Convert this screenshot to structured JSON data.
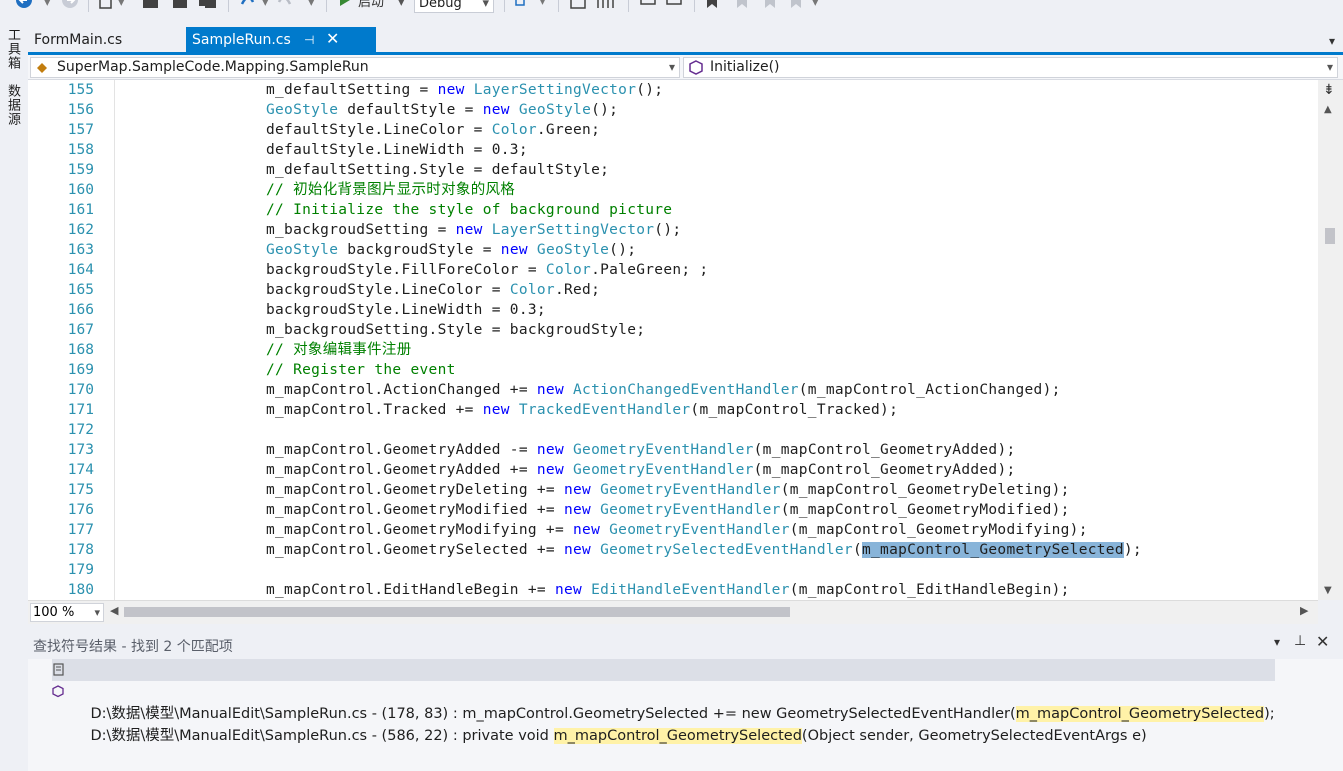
{
  "toolbar": {
    "start_label": "启动",
    "config_value": "Debug"
  },
  "left_strip": {
    "items": [
      {
        "label": "工具箱"
      },
      {
        "label": "数据源"
      }
    ]
  },
  "tabs": [
    {
      "label": "FormMain.cs",
      "active": false
    },
    {
      "label": "SampleRun.cs",
      "active": true
    }
  ],
  "navbar": {
    "class_value": "SuperMap.SampleCode.Mapping.SampleRun",
    "member_value": "Initialize()"
  },
  "editor": {
    "lines": [
      {
        "n": "155",
        "parts": [
          [
            "",
            "m_defaultSetting = "
          ],
          [
            "kw",
            "new"
          ],
          [
            "",
            " "
          ],
          [
            "ty",
            "LayerSettingVector"
          ],
          [
            "",
            "();"
          ]
        ]
      },
      {
        "n": "156",
        "parts": [
          [
            "ty",
            "GeoStyle"
          ],
          [
            "",
            " defaultStyle = "
          ],
          [
            "kw",
            "new"
          ],
          [
            "",
            " "
          ],
          [
            "ty",
            "GeoStyle"
          ],
          [
            "",
            "();"
          ]
        ]
      },
      {
        "n": "157",
        "parts": [
          [
            "",
            "defaultStyle.LineColor = "
          ],
          [
            "ty",
            "Color"
          ],
          [
            "",
            ".Green;"
          ]
        ]
      },
      {
        "n": "158",
        "parts": [
          [
            "",
            "defaultStyle.LineWidth = 0.3;"
          ]
        ]
      },
      {
        "n": "159",
        "parts": [
          [
            "",
            "m_defaultSetting.Style = defaultStyle;"
          ]
        ]
      },
      {
        "n": "160",
        "parts": [
          [
            "cm",
            "// 初始化背景图片显示时对象的风格"
          ]
        ]
      },
      {
        "n": "161",
        "parts": [
          [
            "cm",
            "// Initialize the style of background picture"
          ]
        ]
      },
      {
        "n": "162",
        "parts": [
          [
            "",
            "m_backgroudSetting = "
          ],
          [
            "kw",
            "new"
          ],
          [
            "",
            " "
          ],
          [
            "ty",
            "LayerSettingVector"
          ],
          [
            "",
            "();"
          ]
        ]
      },
      {
        "n": "163",
        "parts": [
          [
            "ty",
            "GeoStyle"
          ],
          [
            "",
            " backgroudStyle = "
          ],
          [
            "kw",
            "new"
          ],
          [
            "",
            " "
          ],
          [
            "ty",
            "GeoStyle"
          ],
          [
            "",
            "();"
          ]
        ]
      },
      {
        "n": "164",
        "parts": [
          [
            "",
            "backgroudStyle.FillForeColor = "
          ],
          [
            "ty",
            "Color"
          ],
          [
            "",
            ".PaleGreen; ;"
          ]
        ]
      },
      {
        "n": "165",
        "parts": [
          [
            "",
            "backgroudStyle.LineColor = "
          ],
          [
            "ty",
            "Color"
          ],
          [
            "",
            ".Red;"
          ]
        ]
      },
      {
        "n": "166",
        "parts": [
          [
            "",
            "backgroudStyle.LineWidth = 0.3;"
          ]
        ]
      },
      {
        "n": "167",
        "parts": [
          [
            "",
            "m_backgroudSetting.Style = backgroudStyle;"
          ]
        ]
      },
      {
        "n": "168",
        "parts": [
          [
            "cm",
            "// 对象编辑事件注册"
          ]
        ]
      },
      {
        "n": "169",
        "parts": [
          [
            "cm",
            "// Register the event"
          ]
        ]
      },
      {
        "n": "170",
        "parts": [
          [
            "",
            "m_mapControl.ActionChanged += "
          ],
          [
            "kw",
            "new"
          ],
          [
            "",
            " "
          ],
          [
            "ty",
            "ActionChangedEventHandler"
          ],
          [
            "",
            "(m_mapControl_ActionChanged);"
          ]
        ]
      },
      {
        "n": "171",
        "parts": [
          [
            "",
            "m_mapControl.Tracked += "
          ],
          [
            "kw",
            "new"
          ],
          [
            "",
            " "
          ],
          [
            "ty",
            "TrackedEventHandler"
          ],
          [
            "",
            "(m_mapControl_Tracked);"
          ]
        ]
      },
      {
        "n": "172",
        "parts": []
      },
      {
        "n": "173",
        "parts": [
          [
            "",
            "m_mapControl.GeometryAdded -= "
          ],
          [
            "kw",
            "new"
          ],
          [
            "",
            " "
          ],
          [
            "ty",
            "GeometryEventHandler"
          ],
          [
            "",
            "(m_mapControl_GeometryAdded);"
          ]
        ]
      },
      {
        "n": "174",
        "parts": [
          [
            "",
            "m_mapControl.GeometryAdded += "
          ],
          [
            "kw",
            "new"
          ],
          [
            "",
            " "
          ],
          [
            "ty",
            "GeometryEventHandler"
          ],
          [
            "",
            "(m_mapControl_GeometryAdded);"
          ]
        ]
      },
      {
        "n": "175",
        "parts": [
          [
            "",
            "m_mapControl.GeometryDeleting += "
          ],
          [
            "kw",
            "new"
          ],
          [
            "",
            " "
          ],
          [
            "ty",
            "GeometryEventHandler"
          ],
          [
            "",
            "(m_mapControl_GeometryDeleting);"
          ]
        ]
      },
      {
        "n": "176",
        "parts": [
          [
            "",
            "m_mapControl.GeometryModified += "
          ],
          [
            "kw",
            "new"
          ],
          [
            "",
            " "
          ],
          [
            "ty",
            "GeometryEventHandler"
          ],
          [
            "",
            "(m_mapControl_GeometryModified);"
          ]
        ]
      },
      {
        "n": "177",
        "parts": [
          [
            "",
            "m_mapControl.GeometryModifying += "
          ],
          [
            "kw",
            "new"
          ],
          [
            "",
            " "
          ],
          [
            "ty",
            "GeometryEventHandler"
          ],
          [
            "",
            "(m_mapControl_GeometryModifying);"
          ]
        ]
      },
      {
        "n": "178",
        "parts": [
          [
            "",
            "m_mapControl.GeometrySelected += "
          ],
          [
            "kw",
            "new"
          ],
          [
            "",
            " "
          ],
          [
            "ty",
            "GeometrySelectedEventHandler"
          ],
          [
            "",
            "("
          ],
          [
            "hl",
            "m_mapControl_GeometrySelected"
          ],
          [
            "",
            ");"
          ]
        ]
      },
      {
        "n": "179",
        "parts": []
      },
      {
        "n": "180",
        "parts": [
          [
            "",
            "m_mapControl.EditHandleBegin += "
          ],
          [
            "kw",
            "new"
          ],
          [
            "",
            " "
          ],
          [
            "ty",
            "EditHandleEventHandler"
          ],
          [
            "",
            "(m_mapControl_EditHandleBegin);"
          ]
        ]
      }
    ]
  },
  "zoom": {
    "value": "100 %"
  },
  "find_results": {
    "title": "查找符号结果 - 找到 2 个匹配项",
    "rows": [
      {
        "prefix": "D:\\数据\\模型\\ManualEdit\\SampleRun.cs - (178, 83) : m_mapControl.GeometrySelected += new GeometrySelectedEventHandler(",
        "match": "m_mapControl_GeometrySelected",
        "suffix": ");"
      },
      {
        "prefix": "D:\\数据\\模型\\ManualEdit\\SampleRun.cs - (586, 22) : private void ",
        "match": "m_mapControl_GeometrySelected",
        "suffix": "(Object sender, GeometrySelectedEventArgs e)"
      }
    ]
  },
  "colors": {
    "accent": "#007acc",
    "keyword": "#0000ff",
    "type": "#2b91af",
    "comment": "#008000",
    "selection": "#88b4d9",
    "match_highlight": "#fff2a8"
  }
}
